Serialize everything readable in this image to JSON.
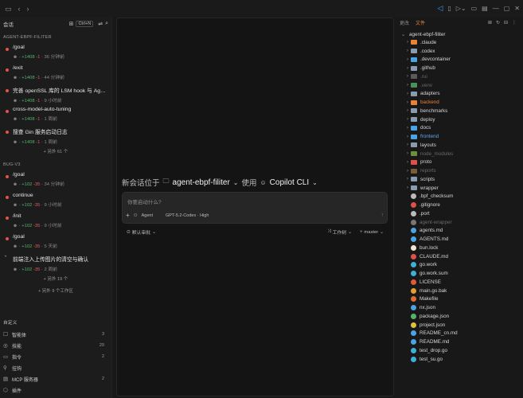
{
  "sidebar": {
    "title": "会话",
    "shortcut": "Ctrl+N",
    "groups": [
      {
        "label": "AGENT-EBPF-FILITER",
        "sessions": [
          {
            "title": "/goal",
            "add": "+1408",
            "del": "-1",
            "time": "36 分钟前"
          },
          {
            "title": "/exit",
            "add": "+1408",
            "del": "-1",
            "time": "44 分钟前"
          },
          {
            "title": "完善 openSSL 库的 LSM hook 与 Agent ...",
            "add": "+1408",
            "del": "-1",
            "time": "9 小时前"
          },
          {
            "title": "cross-model-auto-tuning",
            "add": "+1408",
            "del": "-1",
            "time": "1 周前"
          },
          {
            "title": "搜查 Gin 服务启动日志",
            "add": "+1408",
            "del": "-1",
            "time": "1 周前"
          }
        ],
        "more": "+ 另外 61 个"
      },
      {
        "label": "BUG-V3",
        "sessions": [
          {
            "title": "/goal",
            "add": "+102",
            "del": "-35",
            "time": "34 分钟前"
          },
          {
            "title": "continue",
            "add": "+102",
            "del": "-35",
            "time": "9 小时前"
          },
          {
            "title": "/init",
            "add": "+102",
            "del": "-35",
            "time": "9 小时前"
          },
          {
            "title": "/goal",
            "add": "+102",
            "del": "-35",
            "time": "5 天前"
          },
          {
            "title": "前端注入上传图片的清空与确认",
            "add": "+102",
            "del": "-35",
            "time": "2 周前"
          }
        ],
        "more": "+ 另外 19 个",
        "more2": "+ 另外 9 个工作区"
      }
    ],
    "custom_label": "自定义",
    "custom_items": [
      {
        "icon": "agent-icon",
        "glyph": "☐",
        "name": "智能体",
        "count": "3"
      },
      {
        "icon": "skill-icon",
        "glyph": "◎",
        "name": "技能",
        "count": "29"
      },
      {
        "icon": "command-icon",
        "glyph": "▭",
        "name": "指令",
        "count": "2"
      },
      {
        "icon": "hook-icon",
        "glyph": "⚲",
        "name": "挂钩",
        "count": ""
      },
      {
        "icon": "mcp-icon",
        "glyph": "▤",
        "name": "MCP 服务器",
        "count": "2"
      },
      {
        "icon": "plugin-icon",
        "glyph": "⬡",
        "name": "插件",
        "count": ""
      }
    ]
  },
  "main": {
    "prefix": "新会话位于",
    "workspace": "agent-ebpf-filiter",
    "use": "使用",
    "agent": "Copilot CLI",
    "placeholder": "你要启动什么?",
    "mode": "Agent",
    "model": "GPT-5.2-Codex · High",
    "approval": "默认审批",
    "location": "工作树",
    "branch": "master"
  },
  "right": {
    "tabs": [
      "更改",
      "文件"
    ],
    "root": "agent-ebpf-filiter",
    "items": [
      {
        "name": ".claude",
        "type": "folder",
        "color": "#e8813a",
        "style": ""
      },
      {
        "name": ".codex",
        "type": "folder",
        "color": "#8a9bb0",
        "style": ""
      },
      {
        "name": ".devcontainer",
        "type": "folder",
        "color": "#4ba3e3",
        "style": ""
      },
      {
        "name": ".github",
        "type": "folder",
        "color": "#8a9bb0",
        "style": ""
      },
      {
        "name": ".rui",
        "type": "folder",
        "color": "#5a5a5a",
        "style": "dim"
      },
      {
        "name": ".venv",
        "type": "folder",
        "color": "#4d8f59",
        "style": "dim"
      },
      {
        "name": "adapters",
        "type": "folder",
        "color": "#8a9bb0",
        "style": ""
      },
      {
        "name": "backend",
        "type": "folder",
        "color": "#e8813a",
        "style": "orange"
      },
      {
        "name": "benchmarks",
        "type": "folder",
        "color": "#8a9bb0",
        "style": ""
      },
      {
        "name": "deploy",
        "type": "folder",
        "color": "#8a9bb0",
        "style": ""
      },
      {
        "name": "docs",
        "type": "folder",
        "color": "#4ba3e3",
        "style": ""
      },
      {
        "name": "frontend",
        "type": "folder",
        "color": "#4ba3e3",
        "style": "blue"
      },
      {
        "name": "layouts",
        "type": "folder",
        "color": "#8a9bb0",
        "style": ""
      },
      {
        "name": "node_modules",
        "type": "folder",
        "color": "#6b8f3c",
        "style": "dim"
      },
      {
        "name": "proto",
        "type": "folder",
        "color": "#e0504a",
        "style": ""
      },
      {
        "name": "reports",
        "type": "folder",
        "color": "#7a5a3a",
        "style": "dim"
      },
      {
        "name": "scripts",
        "type": "folder",
        "color": "#8a9bb0",
        "style": ""
      },
      {
        "name": "wrapper",
        "type": "folder",
        "color": "#8a9bb0",
        "style": ""
      },
      {
        "name": ".bpf_checksum",
        "type": "file",
        "color": "#bbbbbb",
        "style": ""
      },
      {
        "name": ".gitignore",
        "type": "file",
        "color": "#e0504a",
        "style": ""
      },
      {
        "name": ".port",
        "type": "file",
        "color": "#bbbbbb",
        "style": ""
      },
      {
        "name": "agent-wrapper",
        "type": "file",
        "color": "#777777",
        "style": "dim"
      },
      {
        "name": "agents.md",
        "type": "file",
        "color": "#4ba3e3",
        "style": ""
      },
      {
        "name": "AGENTS.md",
        "type": "file",
        "color": "#4ba3e3",
        "style": ""
      },
      {
        "name": "bun.lock",
        "type": "file",
        "color": "#f0e6d0",
        "style": ""
      },
      {
        "name": "CLAUDE.md",
        "type": "file",
        "color": "#e0504a",
        "style": ""
      },
      {
        "name": "go.work",
        "type": "file",
        "color": "#3db0d8",
        "style": ""
      },
      {
        "name": "go.work.sum",
        "type": "file",
        "color": "#3db0d8",
        "style": ""
      },
      {
        "name": "LICENSE",
        "type": "file",
        "color": "#e05a3a",
        "style": ""
      },
      {
        "name": "main.go.bak",
        "type": "file",
        "color": "#e0a030",
        "style": ""
      },
      {
        "name": "Makefile",
        "type": "file",
        "color": "#e06a30",
        "style": ""
      },
      {
        "name": "nx.json",
        "type": "file",
        "color": "#4ba3e3",
        "style": ""
      },
      {
        "name": "package.json",
        "type": "file",
        "color": "#56b36a",
        "style": ""
      },
      {
        "name": "project.json",
        "type": "file",
        "color": "#e0c040",
        "style": ""
      },
      {
        "name": "README_cn.md",
        "type": "file",
        "color": "#4ba3e3",
        "style": ""
      },
      {
        "name": "README.md",
        "type": "file",
        "color": "#4ba3e3",
        "style": ""
      },
      {
        "name": "test_drop.go",
        "type": "file",
        "color": "#3db0d8",
        "style": ""
      },
      {
        "name": "test_su.go",
        "type": "file",
        "color": "#3db0d8",
        "style": ""
      }
    ]
  }
}
